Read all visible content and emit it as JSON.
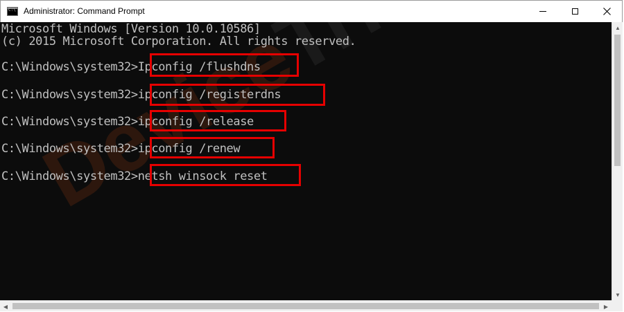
{
  "window": {
    "title": "Administrator: Command Prompt",
    "icon": "cmd-icon",
    "icon_text": "C:\\",
    "controls": {
      "minimize_icon": "minimize-icon",
      "maximize_icon": "maximize-icon",
      "close_icon": "close-icon"
    }
  },
  "console": {
    "background": "#0c0c0c",
    "text_color": "#c0c0c0",
    "header": [
      "Microsoft Windows [Version 10.0.10586]",
      "(c) 2015 Microsoft Corporation. All rights reserved."
    ],
    "prompt": "C:\\Windows\\system32>",
    "commands": [
      "Ipconfig /flushdns",
      "ipconfig /registerdns",
      "ipconfig /release",
      "ipconfig /renew",
      "netsh winsock reset"
    ],
    "highlight_color": "#e60000"
  },
  "watermark": {
    "part1": "Device",
    "part2": "Tricks"
  }
}
